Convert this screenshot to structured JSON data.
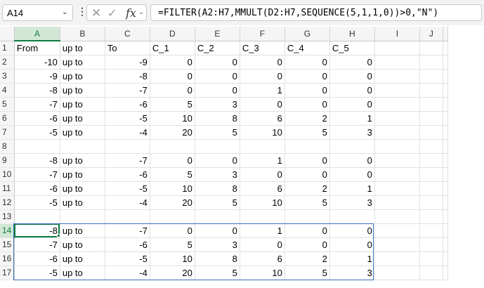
{
  "formula_bar": {
    "name_box": "A14",
    "formula": "=FILTER(A2:H7,MMULT(D2:H7,SEQUENCE(5,1,1,0))>0,\"N\")"
  },
  "columns": [
    "A",
    "B",
    "C",
    "D",
    "E",
    "F",
    "G",
    "H",
    "I",
    "J"
  ],
  "active_cell": "A14",
  "rows": [
    {
      "n": "1",
      "cells": [
        "From",
        "up to",
        "To",
        "C_1",
        "C_2",
        "C_3",
        "C_4",
        "C_5",
        "",
        ""
      ]
    },
    {
      "n": "2",
      "cells": [
        "-10",
        "up to",
        "-9",
        "0",
        "0",
        "0",
        "0",
        "0",
        "",
        ""
      ]
    },
    {
      "n": "3",
      "cells": [
        "-9",
        "up to",
        "-8",
        "0",
        "0",
        "0",
        "0",
        "0",
        "",
        ""
      ]
    },
    {
      "n": "4",
      "cells": [
        "-8",
        "up to",
        "-7",
        "0",
        "0",
        "1",
        "0",
        "0",
        "",
        ""
      ]
    },
    {
      "n": "5",
      "cells": [
        "-7",
        "up to",
        "-6",
        "5",
        "3",
        "0",
        "0",
        "0",
        "",
        ""
      ]
    },
    {
      "n": "6",
      "cells": [
        "-6",
        "up to",
        "-5",
        "10",
        "8",
        "6",
        "2",
        "1",
        "",
        ""
      ]
    },
    {
      "n": "7",
      "cells": [
        "-5",
        "up to",
        "-4",
        "20",
        "5",
        "10",
        "5",
        "3",
        "",
        ""
      ]
    },
    {
      "n": "8",
      "cells": [
        "",
        "",
        "",
        "",
        "",
        "",
        "",
        "",
        "",
        ""
      ]
    },
    {
      "n": "9",
      "cells": [
        "-8",
        "up to",
        "-7",
        "0",
        "0",
        "1",
        "0",
        "0",
        "",
        ""
      ]
    },
    {
      "n": "10",
      "cells": [
        "-7",
        "up to",
        "-6",
        "5",
        "3",
        "0",
        "0",
        "0",
        "",
        ""
      ]
    },
    {
      "n": "11",
      "cells": [
        "-6",
        "up to",
        "-5",
        "10",
        "8",
        "6",
        "2",
        "1",
        "",
        ""
      ]
    },
    {
      "n": "12",
      "cells": [
        "-5",
        "up to",
        "-4",
        "20",
        "5",
        "10",
        "5",
        "3",
        "",
        ""
      ]
    },
    {
      "n": "13",
      "cells": [
        "",
        "",
        "",
        "",
        "",
        "",
        "",
        "",
        "",
        ""
      ]
    },
    {
      "n": "14",
      "cells": [
        "-8",
        "up to",
        "-7",
        "0",
        "0",
        "1",
        "0",
        "0",
        "",
        ""
      ]
    },
    {
      "n": "15",
      "cells": [
        "-7",
        "up to",
        "-6",
        "5",
        "3",
        "0",
        "0",
        "0",
        "",
        ""
      ]
    },
    {
      "n": "16",
      "cells": [
        "-6",
        "up to",
        "-5",
        "10",
        "8",
        "6",
        "2",
        "1",
        "",
        ""
      ]
    },
    {
      "n": "17",
      "cells": [
        "-5",
        "up to",
        "-4",
        "20",
        "5",
        "10",
        "5",
        "3",
        "",
        ""
      ]
    }
  ]
}
